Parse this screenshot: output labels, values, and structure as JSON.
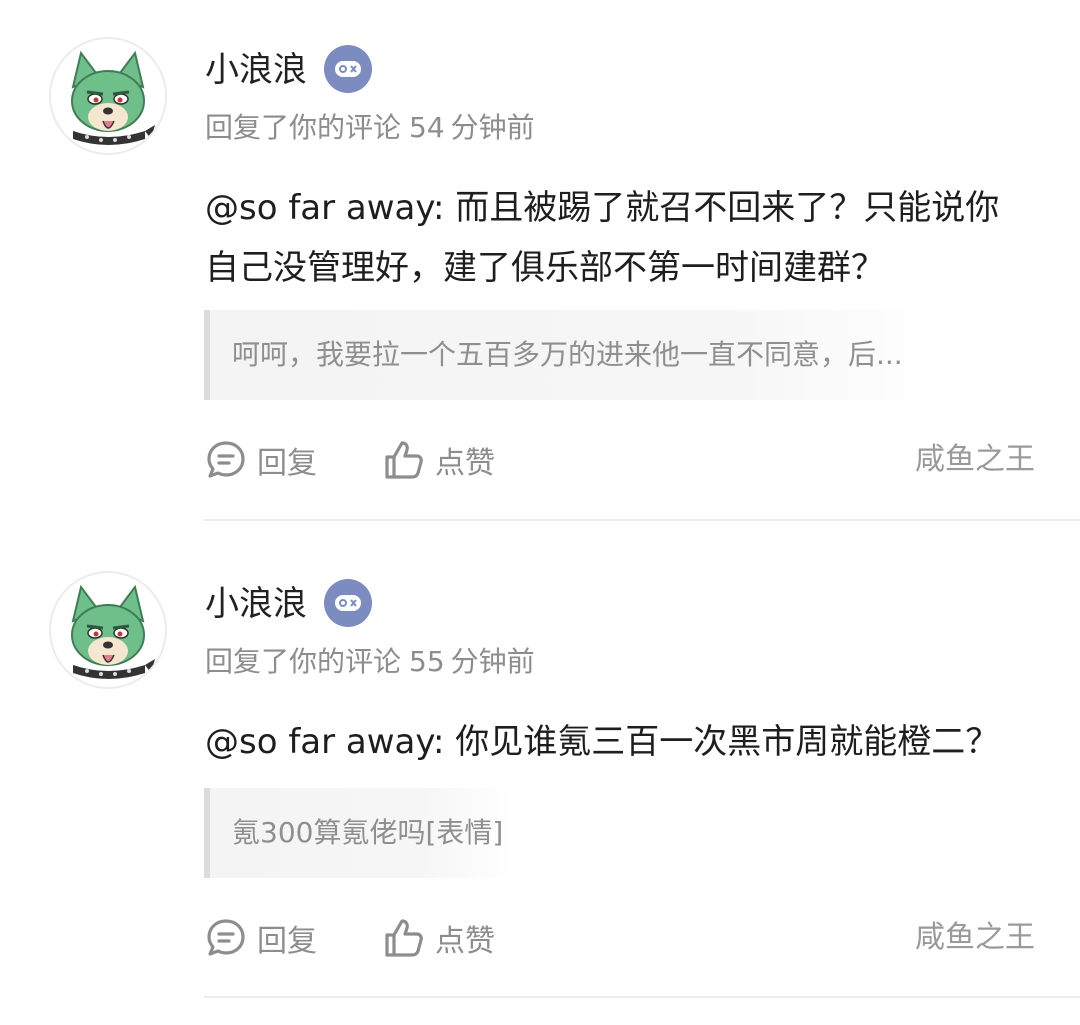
{
  "comments": [
    {
      "author": "小浪浪",
      "badge_icon": "gamepad-icon",
      "meta_prefix": "回复了你的评论",
      "meta_time_value": "54",
      "meta_time_unit": "分钟前",
      "body_line1": "@so far away: 而且被踢了就召不回来了？只能说你",
      "body_line2": "自己没管理好，建了俱乐部不第一时间建群？",
      "quote": "呵呵，我要拉一个五百多万的进来他一直不同意，后...",
      "reply_label": "回复",
      "like_label": "点赞",
      "tag": "咸鱼之王"
    },
    {
      "author": "小浪浪",
      "badge_icon": "gamepad-icon",
      "meta_prefix": "回复了你的评论",
      "meta_time_value": "55",
      "meta_time_unit": "分钟前",
      "body_line1": "@so far away: 你见谁氪三百一次黑市周就能橙二？",
      "quote": "氪300算氪佬吗[表情]",
      "reply_label": "回复",
      "like_label": "点赞",
      "tag": "咸鱼之王"
    }
  ],
  "colors": {
    "badge": "#7c8bc0",
    "avatar_fur": "#6fbf8a",
    "text_primary": "#1e1e1e",
    "text_secondary": "#8d8d8d"
  }
}
